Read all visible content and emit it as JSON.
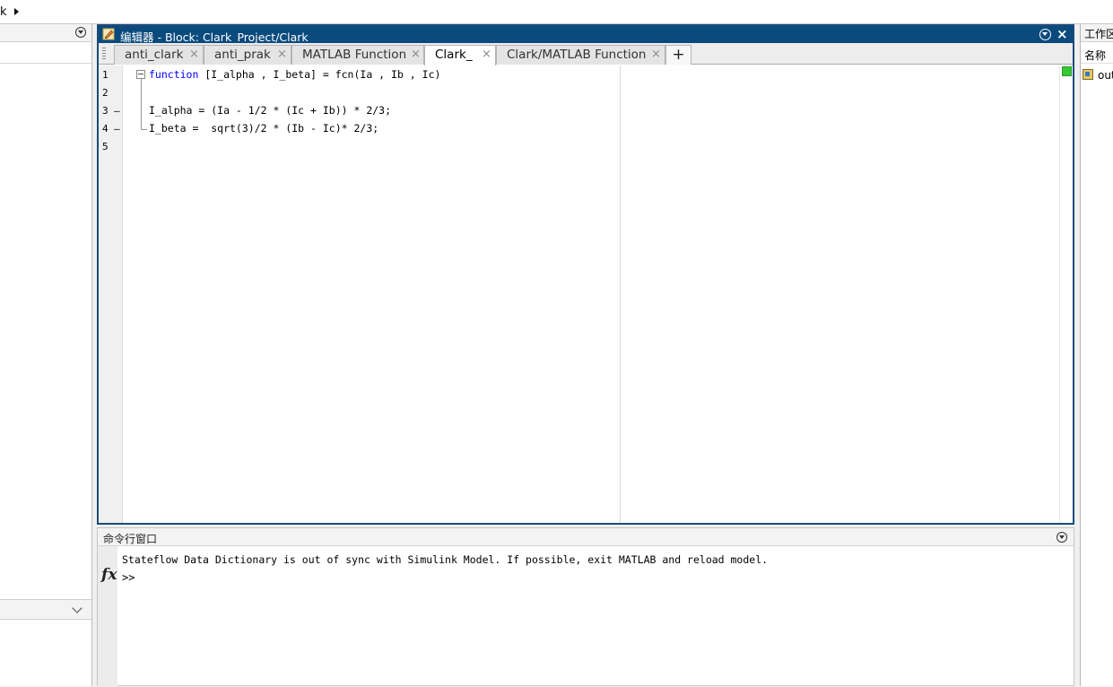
{
  "address_bar": {
    "crumb": "k"
  },
  "editor": {
    "title": "编辑器 - Block: Clark_Project/Clark_",
    "close_glyph": "×",
    "tabs": [
      {
        "label": "anti_clark",
        "close": "×"
      },
      {
        "label": "anti_prak",
        "close": "×"
      },
      {
        "label": "MATLAB Function",
        "close": "×"
      },
      {
        "label": "Clark_",
        "close": "×",
        "active": true
      },
      {
        "label": "Clark/MATLAB Function",
        "close": "×"
      }
    ],
    "add_tab": "+",
    "line_numbers": [
      "1",
      "2",
      "3",
      "4",
      "5"
    ],
    "breakpoint_marks": [
      "–",
      "–"
    ],
    "code": {
      "line1_keyword": "function",
      "line1_rest": " [I_alpha , I_beta] = fcn(Ia , Ib , Ic)",
      "line3": "I_alpha = (Ia - 1/2 * (Ic + Ib)) * 2/3;",
      "line4": "I_beta =  sqrt(3)/2 * (Ib - Ic)* 2/3;"
    }
  },
  "command_window": {
    "title": "命令行窗口",
    "message": "Stateflow Data Dictionary is out of sync with Simulink Model. If possible, exit MATLAB and reload model.",
    "fx": "fx",
    "prompt": ">>"
  },
  "workspace": {
    "title": "工作区",
    "column_name": "名称",
    "variable": "out"
  },
  "colors": {
    "title_bar": "#0b4a7d",
    "keyword": "#0000ff",
    "status_ok": "#36c936"
  }
}
